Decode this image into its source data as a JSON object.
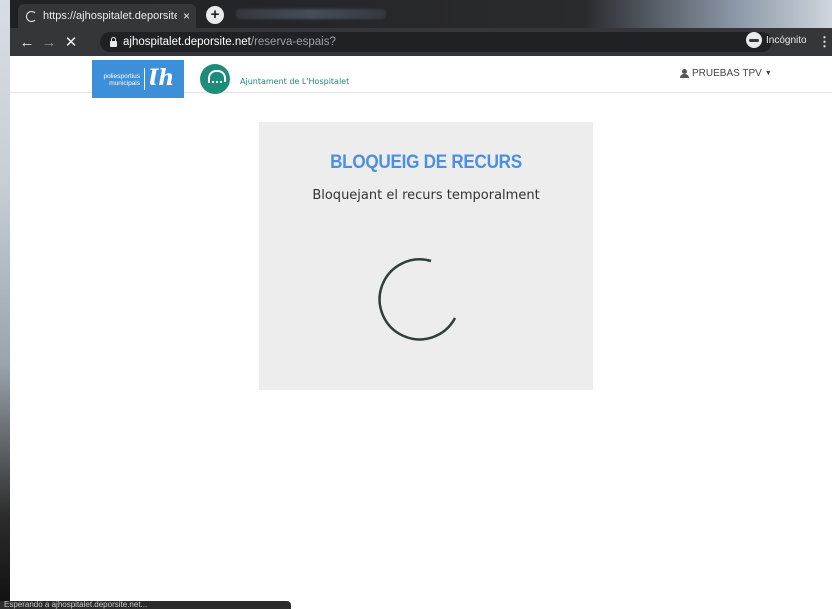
{
  "browser": {
    "tab_title": "https://ajhospitalet.deporsite.net",
    "tab_close": "×",
    "new_tab": "+",
    "url_host": "ajhospitalet.deporsite.net",
    "url_path": "/reserva-espais?",
    "bookmark": "☆",
    "incognito_label": "Incógnito",
    "back": "←",
    "forward": "→",
    "stop": "✕",
    "menu": "⋮"
  },
  "header": {
    "logo_line1": "poliesportius",
    "logo_line2": "municipals",
    "logo_mark": "Ɩh",
    "ajuntament": "Ajuntament de L'Hospitalet",
    "user_name": "PRUEBAS TPV",
    "user_caret": "▼"
  },
  "card": {
    "title": "BLOQUEIG DE RECURS",
    "subtitle": "Bloquejant el recurs temporalment"
  },
  "status": {
    "text": "Esperando a ajhospitalet.deporsite.net..."
  },
  "colors": {
    "accent": "#4a90e2",
    "spinner": "#2f3f3a",
    "ajt_green": "#1f8b7a"
  }
}
